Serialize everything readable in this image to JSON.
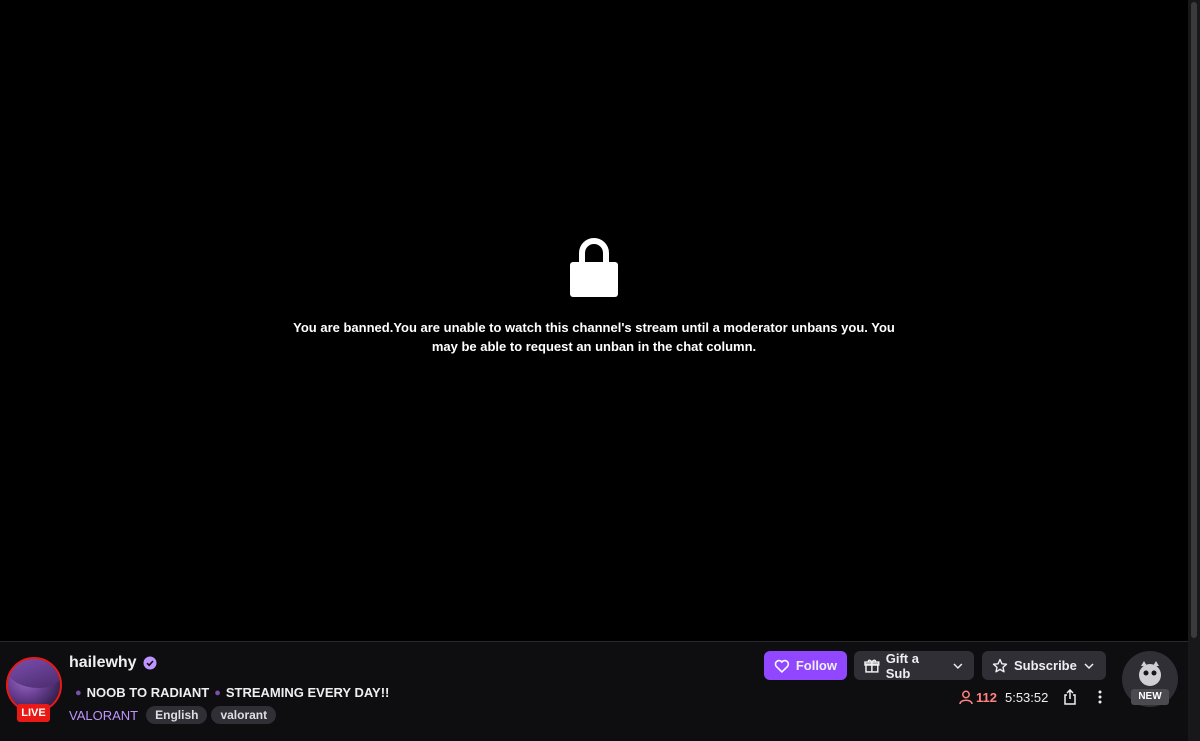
{
  "ban": {
    "line1": "You are banned.You are unable to watch this channel's stream until a moderator unbans you. You",
    "line2": "may be able to request an unban in the chat column.",
    "icon": "lock-icon"
  },
  "channel": {
    "name": "hailewhy",
    "live_label": "LIVE",
    "title_part1": "NOOB TO RADIANT",
    "title_part2": "STREAMING EVERY DAY!!",
    "category": "VALORANT",
    "tags": [
      "English",
      "valorant"
    ]
  },
  "actions": {
    "follow_label": "Follow",
    "gift_label": "Gift a Sub",
    "subscribe_label": "Subscribe"
  },
  "stats": {
    "viewers": "112",
    "uptime": "5:53:52"
  },
  "badge": {
    "new_label": "NEW"
  },
  "colors": {
    "accent": "#9147ff",
    "live": "#e91916",
    "category": "#bf94ff",
    "viewers": "#ff8280"
  }
}
